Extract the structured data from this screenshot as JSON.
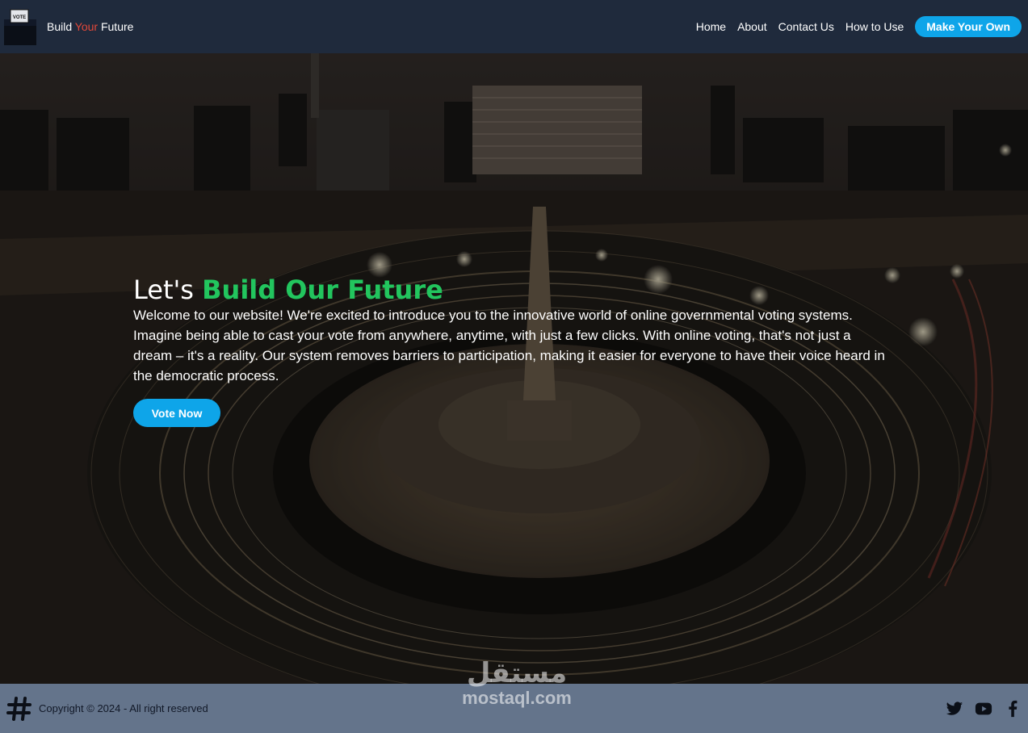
{
  "header": {
    "brand": {
      "part1": "Build ",
      "accent": "Your",
      "part2": " Future",
      "logo_label": "VOTE"
    },
    "nav": [
      {
        "label": "Home"
      },
      {
        "label": "About"
      },
      {
        "label": "Contact Us"
      },
      {
        "label": "How to Use"
      }
    ],
    "cta_label": "Make Your Own"
  },
  "hero": {
    "title_plain": "Let's ",
    "title_highlight": "Build Our Future",
    "body": "Welcome to our website! We're excited to introduce you to the innovative world of online governmental voting systems. Imagine being able to cast your vote from anywhere, anytime, with just a few clicks. With online voting, that's not just a dream – it's a reality. Our system removes barriers to participation, making it easier for everyone to have their voice heard in the democratic process.",
    "button_label": "Vote Now"
  },
  "footer": {
    "copyright": "Copyright © 2024 - All right reserved",
    "icons": [
      "hashtag-icon",
      "twitter-icon",
      "youtube-icon",
      "facebook-icon"
    ]
  },
  "watermark": {
    "arabic": "مستقل",
    "latin": "mostaql.com"
  },
  "colors": {
    "nav_bg": "#1f2a3c",
    "accent_red": "#e2483a",
    "primary": "#0ea5e9",
    "highlight_green": "#22c55e",
    "footer_bg": "#64748b"
  }
}
